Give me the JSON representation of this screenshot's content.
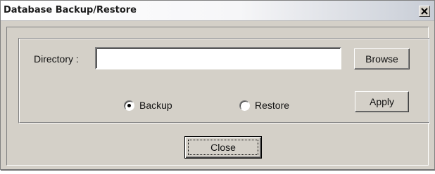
{
  "window": {
    "title": "Database Backup/Restore",
    "close_icon": "close-x-icon"
  },
  "directory": {
    "label": "Directory :",
    "value": "",
    "browse_label": "Browse"
  },
  "mode": {
    "options": [
      {
        "label": "Backup",
        "selected": true
      },
      {
        "label": "Restore",
        "selected": false
      }
    ],
    "apply_label": "Apply"
  },
  "footer": {
    "close_label": "Close"
  }
}
